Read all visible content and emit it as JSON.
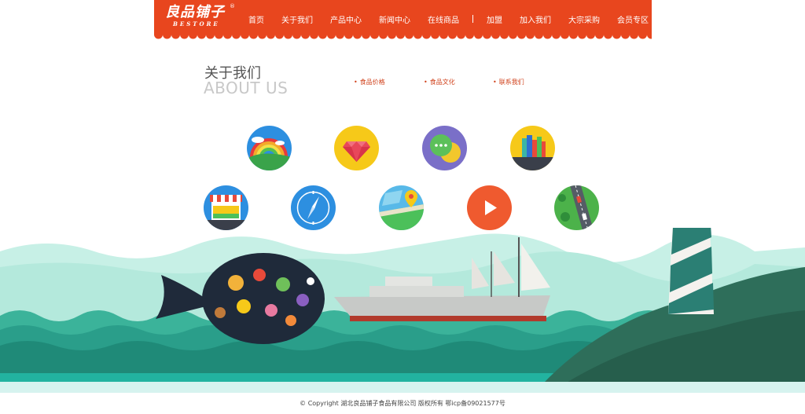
{
  "logo": {
    "cn": "良品铺子",
    "en": "BESTORE",
    "reg": "®"
  },
  "nav": {
    "items": [
      "首页",
      "关于我们",
      "产品中心",
      "新闻中心",
      "在线商品"
    ],
    "items2": [
      "加盟",
      "加入我们",
      "大宗采购",
      "会员专区"
    ]
  },
  "about": {
    "title_cn": "关于我们",
    "title_en": "ABOUT US",
    "links": [
      "食品价格",
      "食品文化",
      "联系我们"
    ]
  },
  "icons": [
    {
      "name": "rainbow-icon"
    },
    {
      "name": "gem-icon"
    },
    {
      "name": "chat-icon"
    },
    {
      "name": "books-icon"
    },
    {
      "name": "store-icon"
    },
    {
      "name": "compass-icon"
    },
    {
      "name": "map-icon"
    },
    {
      "name": "play-icon"
    },
    {
      "name": "road-icon"
    }
  ],
  "colors": {
    "brand": "#e8461e",
    "sea": "#2a9e8a",
    "sky_wave": "#bfeee6"
  },
  "footer": {
    "text": "© Copyright 湖北良品铺子食品有限公司 版权所有 鄂icp备09021577号"
  }
}
